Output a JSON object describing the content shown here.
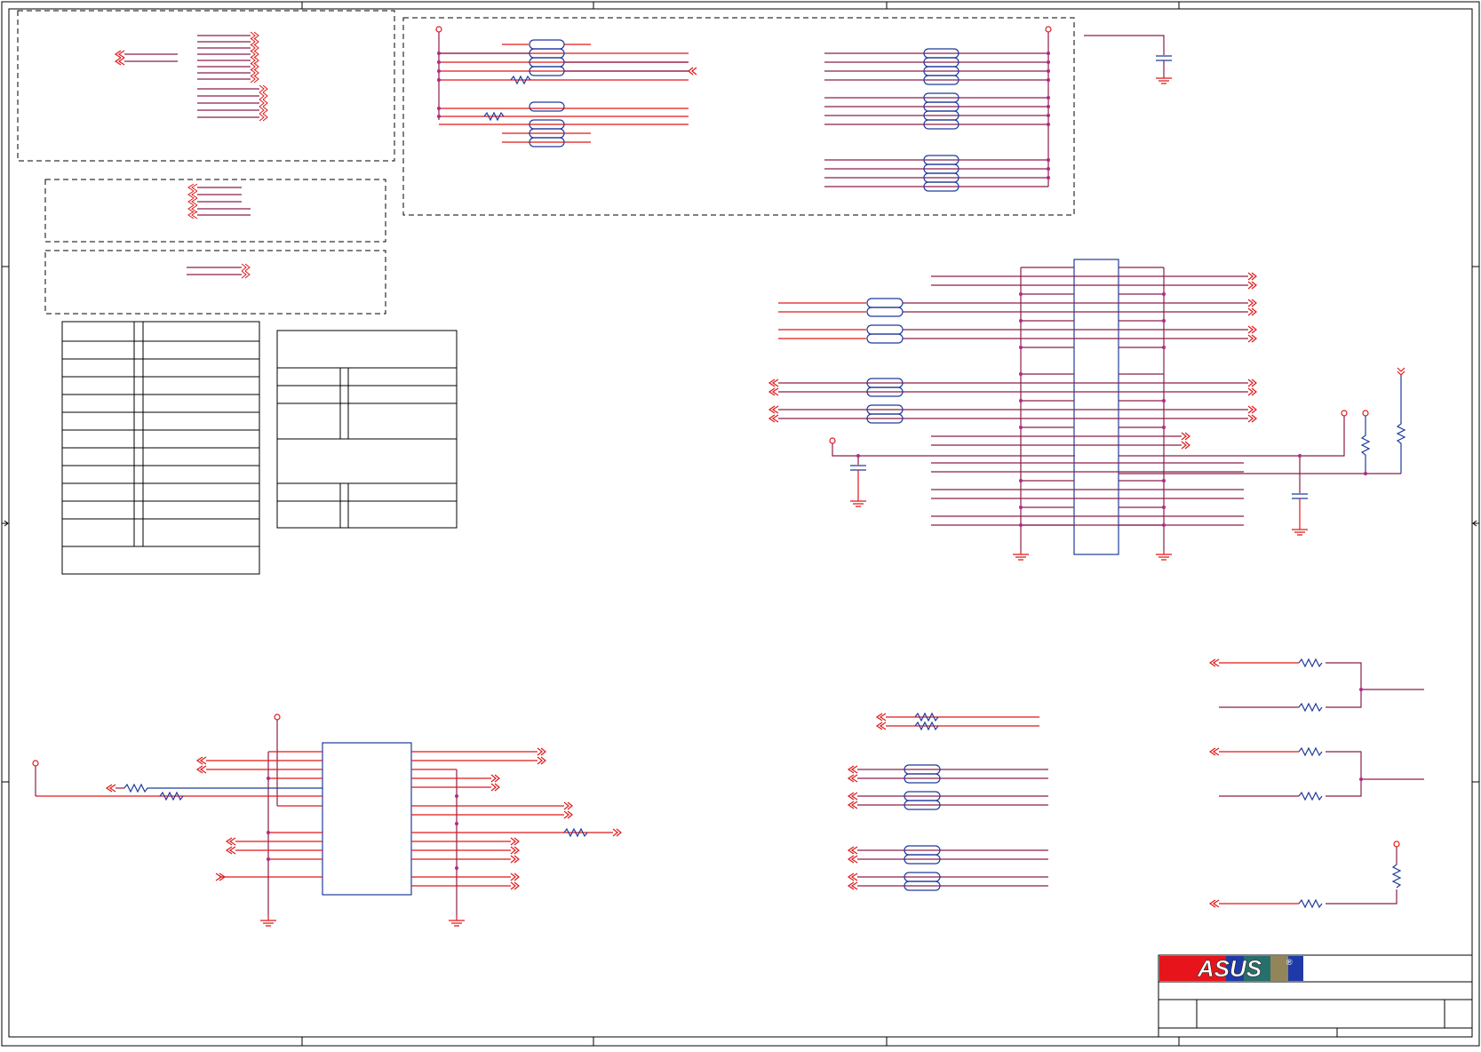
{
  "logo": {
    "text": "ASUS",
    "mark": "®"
  },
  "colors": {
    "background": "#ffffff",
    "frame": "#000000",
    "wire": "#e01818",
    "bus": "#8b1d4a",
    "component": "#1f3b9c",
    "junction": "#b02a8a",
    "logo_red": "#e8141c",
    "logo_blue": "#1f3aa8"
  },
  "title_block": {
    "company": "",
    "title": "",
    "size": "",
    "rev": "",
    "sheet": ""
  },
  "tables": {
    "left_rows": [],
    "right_rows": []
  }
}
